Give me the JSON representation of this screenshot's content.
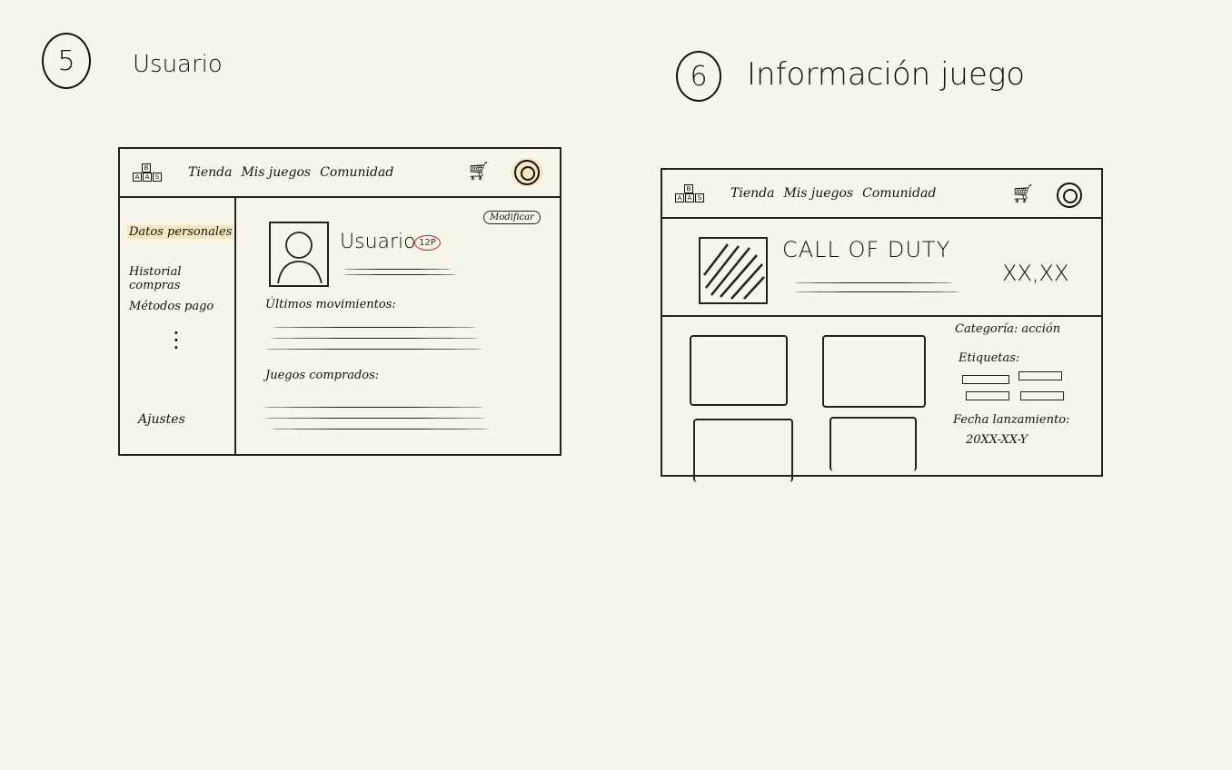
{
  "sections": {
    "user": {
      "number": "5",
      "title": "Usuario",
      "nav": {
        "items": [
          "Tienda",
          "Mis juegos",
          "Comunidad"
        ],
        "logo_letters": [
          "A",
          "A",
          "S"
        ],
        "logo_top_letter": "B"
      },
      "sidebar": {
        "items": [
          "Datos personales",
          "Historial compras",
          "Métodos pago"
        ],
        "ellipsis": "⋮",
        "settings": "Ajustes"
      },
      "profile": {
        "name": "Usuario",
        "badge": "12P",
        "edit_button": "Modificar",
        "recent_label": "Últimos movimientos:",
        "games_label": "Juegos comprados:"
      }
    },
    "game": {
      "number": "6",
      "title": "Información juego",
      "nav": {
        "items": [
          "Tienda",
          "Mis juegos",
          "Comunidad"
        ],
        "logo_letters": [
          "A",
          "A",
          "S"
        ],
        "logo_top_letter": "B"
      },
      "header": {
        "title": "CALL OF DUTY",
        "price": "XX,XX"
      },
      "info": {
        "category": "Categoría: acción",
        "tags_label": "Etiquetas:",
        "release_label": "Fecha lanzamiento:",
        "release_date": "20XX-XX-Y"
      }
    }
  },
  "colors": {
    "background": "#f7f6ea",
    "highlight": "#f4e7bf",
    "badge_red": "#c0262b",
    "ink": "#111111"
  },
  "icons": [
    "cart-icon",
    "avatar-icon",
    "profile-picture-icon",
    "game-cover-icon"
  ]
}
